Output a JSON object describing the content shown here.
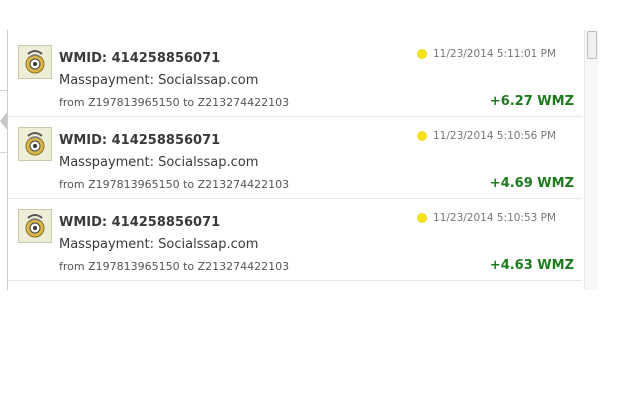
{
  "transactions": [
    {
      "wmid": "WMID: 414258856071",
      "title": "Masspayment: Socialssap.com",
      "route": "from Z197813965150 to Z213274422103",
      "time": "11/23/2014 5:11:01 PM",
      "amount": "+6.27 WMZ",
      "status_color": "#f5df1a",
      "icon": "webmoney-avatar-icon"
    },
    {
      "wmid": "WMID: 414258856071",
      "title": "Masspayment: Socialssap.com",
      "route": "from Z197813965150 to Z213274422103",
      "time": "11/23/2014 5:10:56 PM",
      "amount": "+4.69 WMZ",
      "status_color": "#f5df1a",
      "icon": "webmoney-avatar-icon"
    },
    {
      "wmid": "WMID: 414258856071",
      "title": "Masspayment: Socialssap.com",
      "route": "from Z197813965150 to Z213274422103",
      "time": "11/23/2014 5:10:53 PM",
      "amount": "+4.63 WMZ",
      "status_color": "#f5df1a",
      "icon": "webmoney-avatar-icon"
    }
  ],
  "colors": {
    "amount_positive": "#1d7a1d",
    "status_pending": "#f5df1a"
  }
}
